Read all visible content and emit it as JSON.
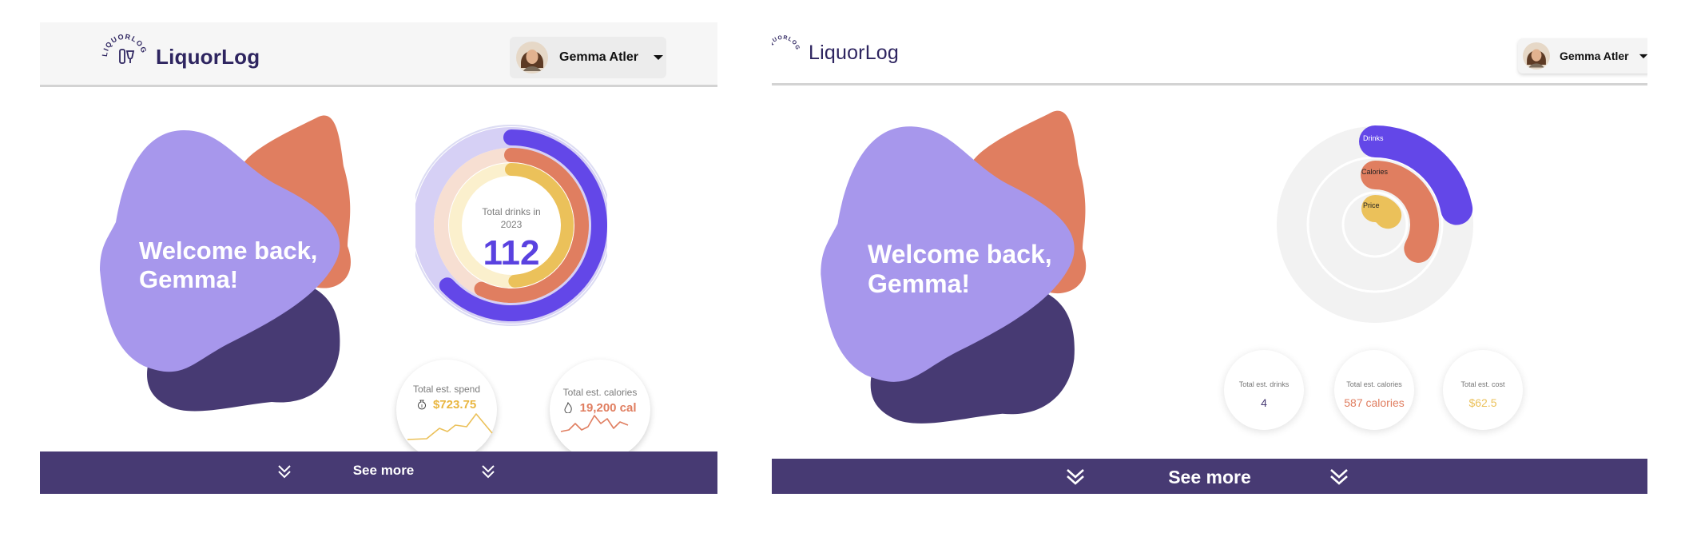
{
  "app": {
    "name": "LiquorLog",
    "logo_ring_text": "LIQUORLOG"
  },
  "user": {
    "name": "Gemma Atler",
    "avatar_icon": "woman-portrait"
  },
  "colors": {
    "purple_dark": "#473a73",
    "purple_brand": "#5a42e0",
    "purple_light": "#a797ec",
    "orange": "#e07e60",
    "yellow": "#ebc15a",
    "cream": "#fbf0cd"
  },
  "dashboard_a": {
    "welcome_line1": "Welcome back,",
    "welcome_line2": "Gemma!",
    "ring_label_line1": "Total drinks in",
    "ring_label_line2": "2023",
    "ring_value": "112",
    "ring_progress": {
      "drinks": 0.63,
      "calories": 0.57,
      "price": 0.49
    },
    "spend_title": "Total est. spend",
    "spend_value": "$723.75",
    "spend_icon": "money-bag-icon",
    "calories_title": "Total est. calories",
    "calories_value": "19,200 cal",
    "calories_icon": "flame-icon",
    "see_more": "See more"
  },
  "dashboard_b": {
    "welcome_line1": "Welcome back,",
    "welcome_line2": "Gemma!",
    "radial_labels": [
      "Drinks",
      "Calories",
      "Price"
    ],
    "radial_progress": {
      "drinks": 0.22,
      "calories": 0.33,
      "price": 0.15
    },
    "stats": [
      {
        "title": "Total est. drinks",
        "value": "4"
      },
      {
        "title": "Total est. calories",
        "value": "587 calories"
      },
      {
        "title": "Total est. cost",
        "value": "$62.5"
      }
    ],
    "see_more": "See more"
  }
}
